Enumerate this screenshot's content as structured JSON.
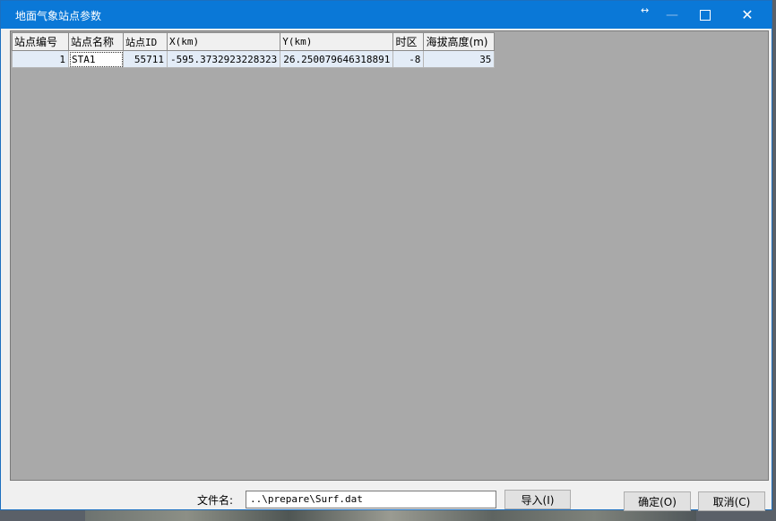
{
  "window": {
    "title": "地面气象站点参数"
  },
  "grid": {
    "headers": [
      "站点编号",
      "站点名称",
      "站点ID",
      "X(km)",
      "Y(km)",
      "时区",
      "海拔高度(m)"
    ],
    "rows": [
      [
        "1",
        "STA1",
        "55711",
        "-595.3732923228323",
        "26.250079646318891",
        "-8",
        "35"
      ]
    ]
  },
  "footer": {
    "file_label": "文件名:",
    "file_value": "..\\prepare\\Surf.dat",
    "import_label": "导入(I)",
    "ok_label": "确定(O)",
    "cancel_label": "取消(C)"
  },
  "colors": {
    "titlebar": "#0a78d7",
    "grid_background": "#a9a9a9"
  }
}
